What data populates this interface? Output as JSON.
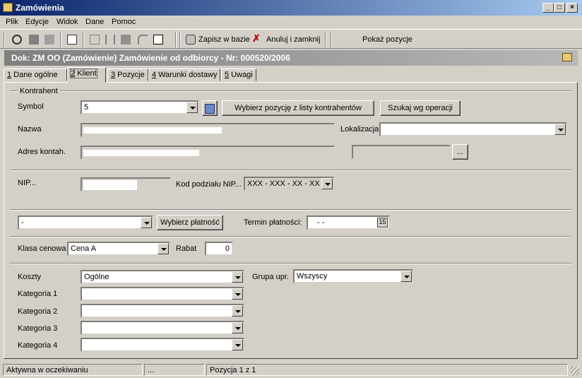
{
  "window": {
    "title": "Zamówienia",
    "minimize": "_",
    "maximize": "□",
    "close": "×"
  },
  "menu": [
    "Plik",
    "Edycje",
    "Widok",
    "Dane",
    "Pomoc"
  ],
  "toolbar": {
    "save_label": "Zapisz w bazie",
    "cancel_label": "Anuluj i zamknij",
    "show_label": "Pokaż pozycje"
  },
  "doc_header": "Dok: ZM OO (Zamówienie)  Zamówienie od odbiorcy  -  Nr: 000520/2006",
  "tabs": [
    {
      "key": "1",
      "label": " Dane ogólne"
    },
    {
      "key": "2",
      "label": " Klient"
    },
    {
      "key": "3",
      "label": " Pozycje"
    },
    {
      "key": "4",
      "label": " Warunki dostawy"
    },
    {
      "key": "5",
      "label": " Uwagi"
    }
  ],
  "kontrahent": {
    "group_label": "Kontrahent",
    "symbol_label": "Symbol",
    "symbol_value": "5",
    "select_button": "Wybierz pozycję z listy kontrahentów",
    "search_button": "Szukaj wg operacji",
    "nazwa_label": "Nazwa",
    "lokalizacja_label": "Lokalizacja",
    "lokalizacja_value": "",
    "adres_label": "Adres kontah.",
    "ellipsis_button": "..."
  },
  "nip": {
    "label": "NIP...",
    "kod_label": "Kod podziału NIP...",
    "kod_value": "XXX - XXX - XX - XX"
  },
  "payment": {
    "method_value": "-",
    "select_button": "Wybierz płatność",
    "termin_label": "Termin płatności:",
    "termin_value": "-   -",
    "calendar_text": "15"
  },
  "price": {
    "klasa_label": "Klasa cenowa",
    "klasa_value": "Cena A",
    "rabat_label": "Rabat",
    "rabat_value": "0"
  },
  "costs": {
    "koszty_label": "Koszty",
    "koszty_value": "Ogólne",
    "grupa_label": "Grupa upr.",
    "grupa_value": "Wszyscy",
    "kategorie": [
      {
        "label": "Kategoria 1",
        "value": ""
      },
      {
        "label": "Kategoria 2",
        "value": ""
      },
      {
        "label": "Kategoria 3",
        "value": ""
      },
      {
        "label": "Kategoria 4",
        "value": ""
      }
    ]
  },
  "status": {
    "state": "Aktywna w oczekiwaniu",
    "dots": "...",
    "position": "Pozycja 1 z 1"
  }
}
